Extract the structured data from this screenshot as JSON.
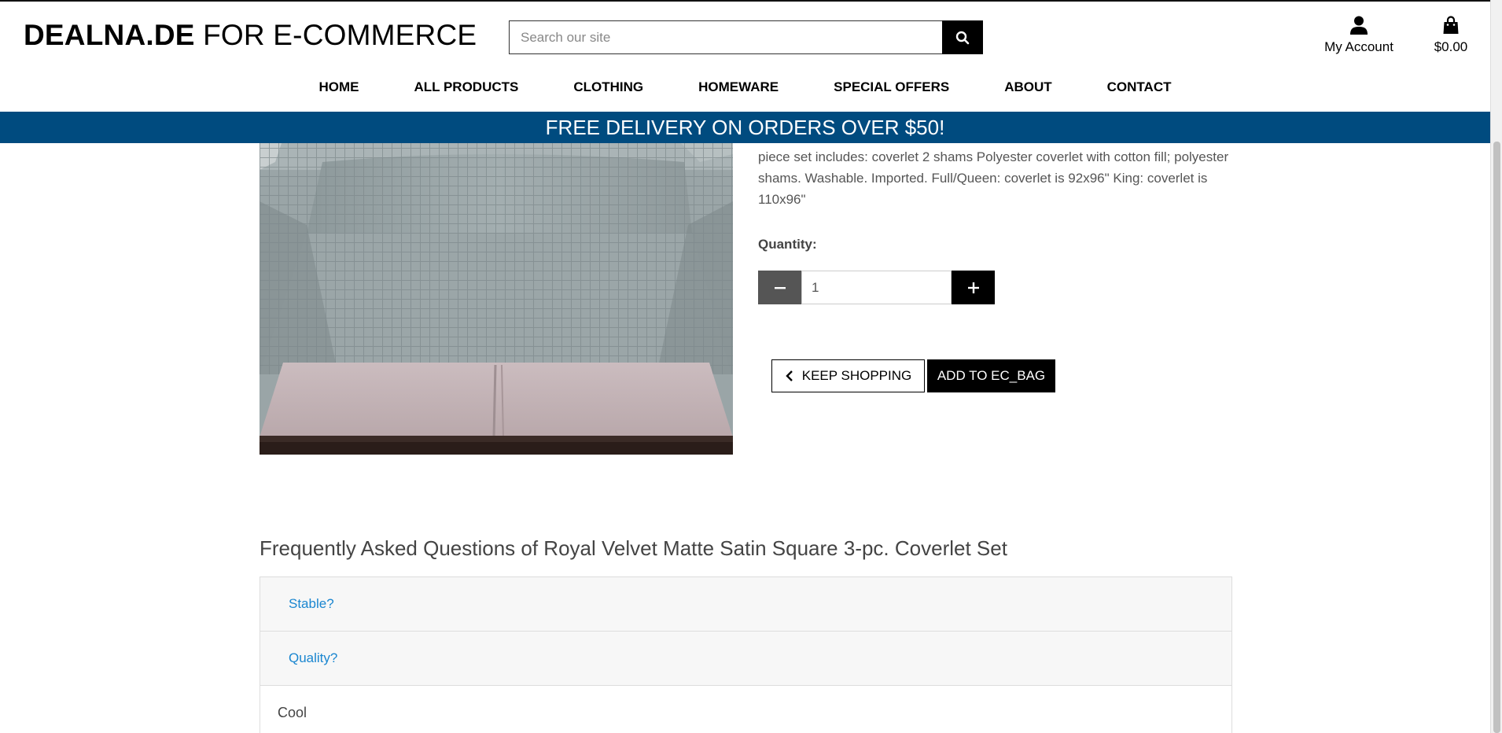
{
  "header": {
    "logo_bold": "DEALNA.DE",
    "logo_rest": " FOR E-COMMERCE",
    "search_placeholder": "Search our site",
    "account_label": "My Account",
    "bag_total": "$0.00",
    "nav": [
      "HOME",
      "ALL PRODUCTS",
      "CLOTHING",
      "HOMEWARE",
      "SPECIAL OFFERS",
      "ABOUT",
      "CONTACT"
    ]
  },
  "banner": {
    "text": "FREE DELIVERY ON ORDERS OVER $50!"
  },
  "product": {
    "description": "piece set includes: coverlet 2 shams Polyester coverlet with cotton fill; polyester shams. Washable. Imported. Full/Queen: coverlet is 92x96\" King: coverlet is 110x96\"",
    "quantity_label": "Quantity:",
    "quantity_value": "1",
    "keep_shopping_label": "KEEP SHOPPING",
    "add_to_bag_label": "ADD TO EC_BAG"
  },
  "faq": {
    "title": "Frequently Asked Questions of Royal Velvet Matte Satin Square 3-pc. Coverlet Set",
    "items": [
      {
        "question": "Stable?"
      },
      {
        "question": "Quality?",
        "answer": "Cool"
      }
    ]
  },
  "icons": {
    "search": "search-icon",
    "account": "user-icon",
    "bag": "shopping-bag-icon",
    "minus": "minus-icon",
    "plus": "plus-icon",
    "back": "chevron-left-icon"
  },
  "colors": {
    "banner": "#004b7f",
    "link": "#1a86d0"
  }
}
